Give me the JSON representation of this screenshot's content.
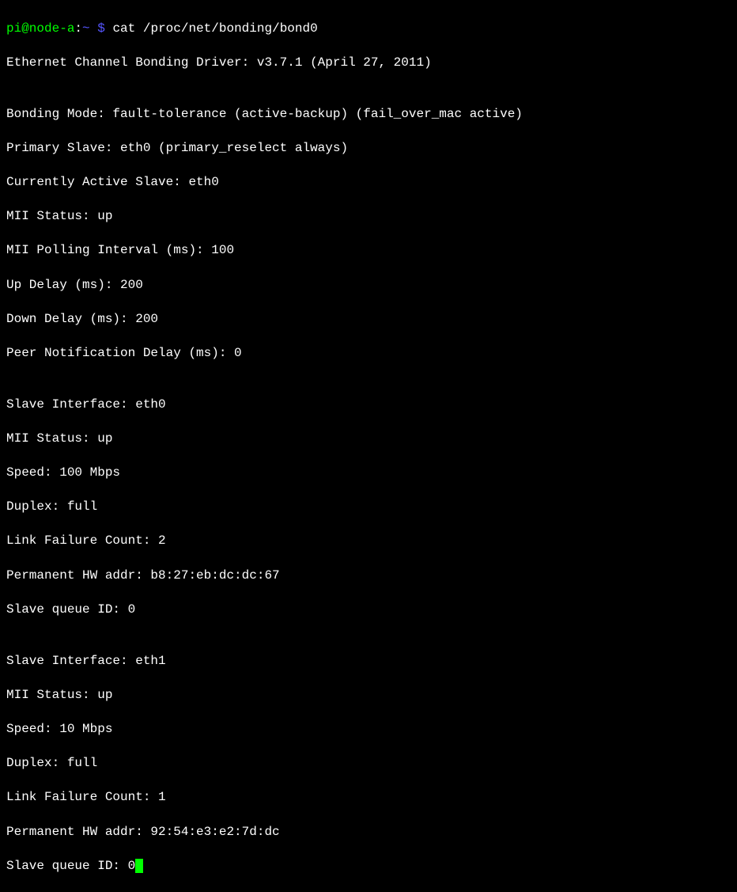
{
  "prompt": {
    "user_host": "pi@node-a",
    "separator": ":",
    "path": "~ $",
    "command": "cat /proc/net/bonding/bond0"
  },
  "output": {
    "driver_line": "Ethernet Channel Bonding Driver: v3.7.1 (April 27, 2011)",
    "blank1": "",
    "bonding_mode": "Bonding Mode: fault-tolerance (active-backup) (fail_over_mac active)",
    "primary_slave": "Primary Slave: eth0 (primary_reselect always)",
    "active_slave": "Currently Active Slave: eth0",
    "mii_status": "MII Status: up",
    "mii_polling": "MII Polling Interval (ms): 100",
    "up_delay": "Up Delay (ms): 200",
    "down_delay": "Down Delay (ms): 200",
    "peer_notification": "Peer Notification Delay (ms): 0",
    "blank2": "",
    "slave1_interface": "Slave Interface: eth0",
    "slave1_mii": "MII Status: up",
    "slave1_speed": "Speed: 100 Mbps",
    "slave1_duplex": "Duplex: full",
    "slave1_failures": "Link Failure Count: 2",
    "slave1_hwaddr": "Permanent HW addr: b8:27:eb:dc:dc:67",
    "slave1_queue": "Slave queue ID: 0",
    "blank3": "",
    "slave2_interface": "Slave Interface: eth1",
    "slave2_mii": "MII Status: up",
    "slave2_speed": "Speed: 10 Mbps",
    "slave2_duplex": "Duplex: full",
    "slave2_failures": "Link Failure Count: 1",
    "slave2_hwaddr": "Permanent HW addr: 92:54:e3:e2:7d:dc",
    "slave2_queue": "Slave queue ID: 0"
  }
}
